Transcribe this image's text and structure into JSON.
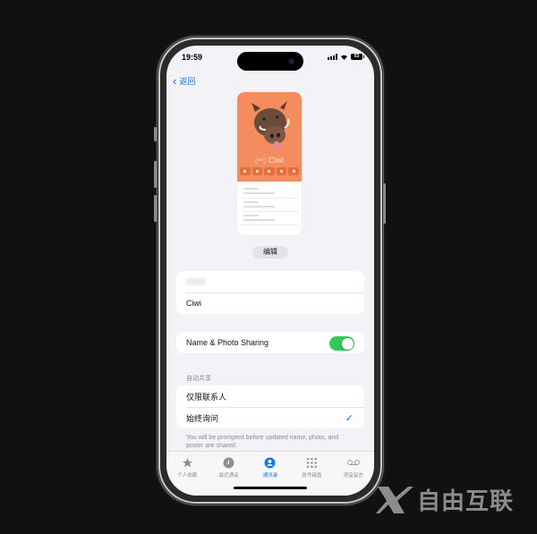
{
  "status_bar": {
    "time": "19:59",
    "battery": "53"
  },
  "nav": {
    "back_label": "返回"
  },
  "poster": {
    "name_prefix": "(••)",
    "name": "Ciwi",
    "background_color": "#f48c5e"
  },
  "edit_button": {
    "label": "编辑"
  },
  "name_fields": {
    "first_name": "",
    "last_name": "Ciwi"
  },
  "sharing": {
    "label": "Name & Photo Sharing",
    "enabled": true
  },
  "auto_share": {
    "section_title": "自动共享",
    "options": [
      {
        "label": "仅限联系人",
        "selected": false
      },
      {
        "label": "始终询问",
        "selected": true
      }
    ],
    "check_glyph": "✓",
    "footnote": "You will be prompted before updated name, photo, and poster are shared."
  },
  "tabbar": {
    "items": [
      {
        "label": "个人收藏",
        "icon": "star-icon",
        "active": false
      },
      {
        "label": "最近通话",
        "icon": "clock-icon",
        "active": false
      },
      {
        "label": "通讯录",
        "icon": "person-circle-icon",
        "active": true
      },
      {
        "label": "拨号键盘",
        "icon": "keypad-icon",
        "active": false
      },
      {
        "label": "语音留言",
        "icon": "voicemail-icon",
        "active": false
      }
    ]
  },
  "watermark": {
    "text": "自由互联"
  },
  "colors": {
    "accent": "#1a73e8",
    "toggle_on": "#34c759",
    "poster": "#f48c5e"
  }
}
